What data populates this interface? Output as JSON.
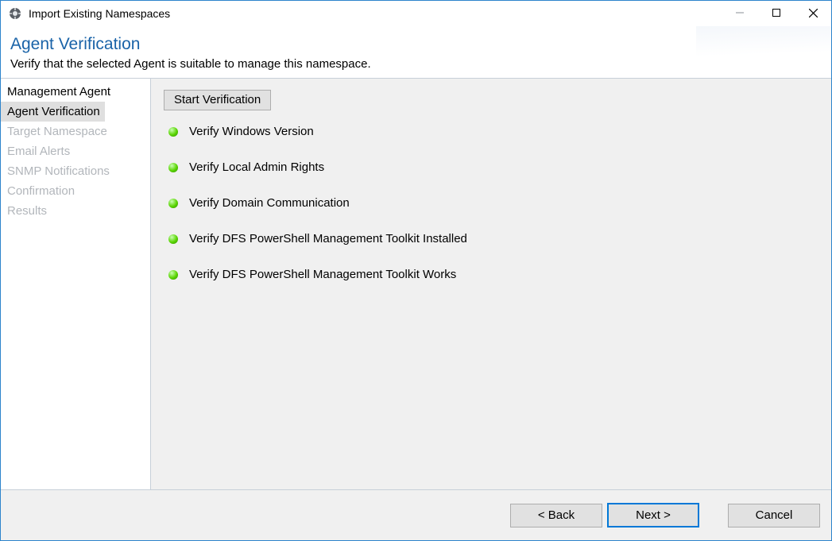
{
  "window": {
    "title": "Import Existing Namespaces"
  },
  "header": {
    "headline": "Agent Verification",
    "subhead": "Verify that the selected Agent is suitable to manage this namespace."
  },
  "sidebar": {
    "steps": [
      {
        "label": "Management Agent",
        "state": "done"
      },
      {
        "label": "Agent Verification",
        "state": "current"
      },
      {
        "label": "Target Namespace",
        "state": "pending"
      },
      {
        "label": "Email Alerts",
        "state": "pending"
      },
      {
        "label": "SNMP Notifications",
        "state": "pending"
      },
      {
        "label": "Confirmation",
        "state": "pending"
      },
      {
        "label": "Results",
        "state": "pending"
      }
    ]
  },
  "content": {
    "verify_button": "Start Verification",
    "checks": [
      {
        "label": "Verify Windows Version",
        "status": "ok"
      },
      {
        "label": "Verify Local Admin Rights",
        "status": "ok"
      },
      {
        "label": "Verify Domain Communication",
        "status": "ok"
      },
      {
        "label": "Verify DFS PowerShell Management Toolkit Installed",
        "status": "ok"
      },
      {
        "label": "Verify DFS PowerShell Management Toolkit Works",
        "status": "ok"
      }
    ]
  },
  "footer": {
    "back": "< Back",
    "next": "Next >",
    "cancel": "Cancel"
  }
}
